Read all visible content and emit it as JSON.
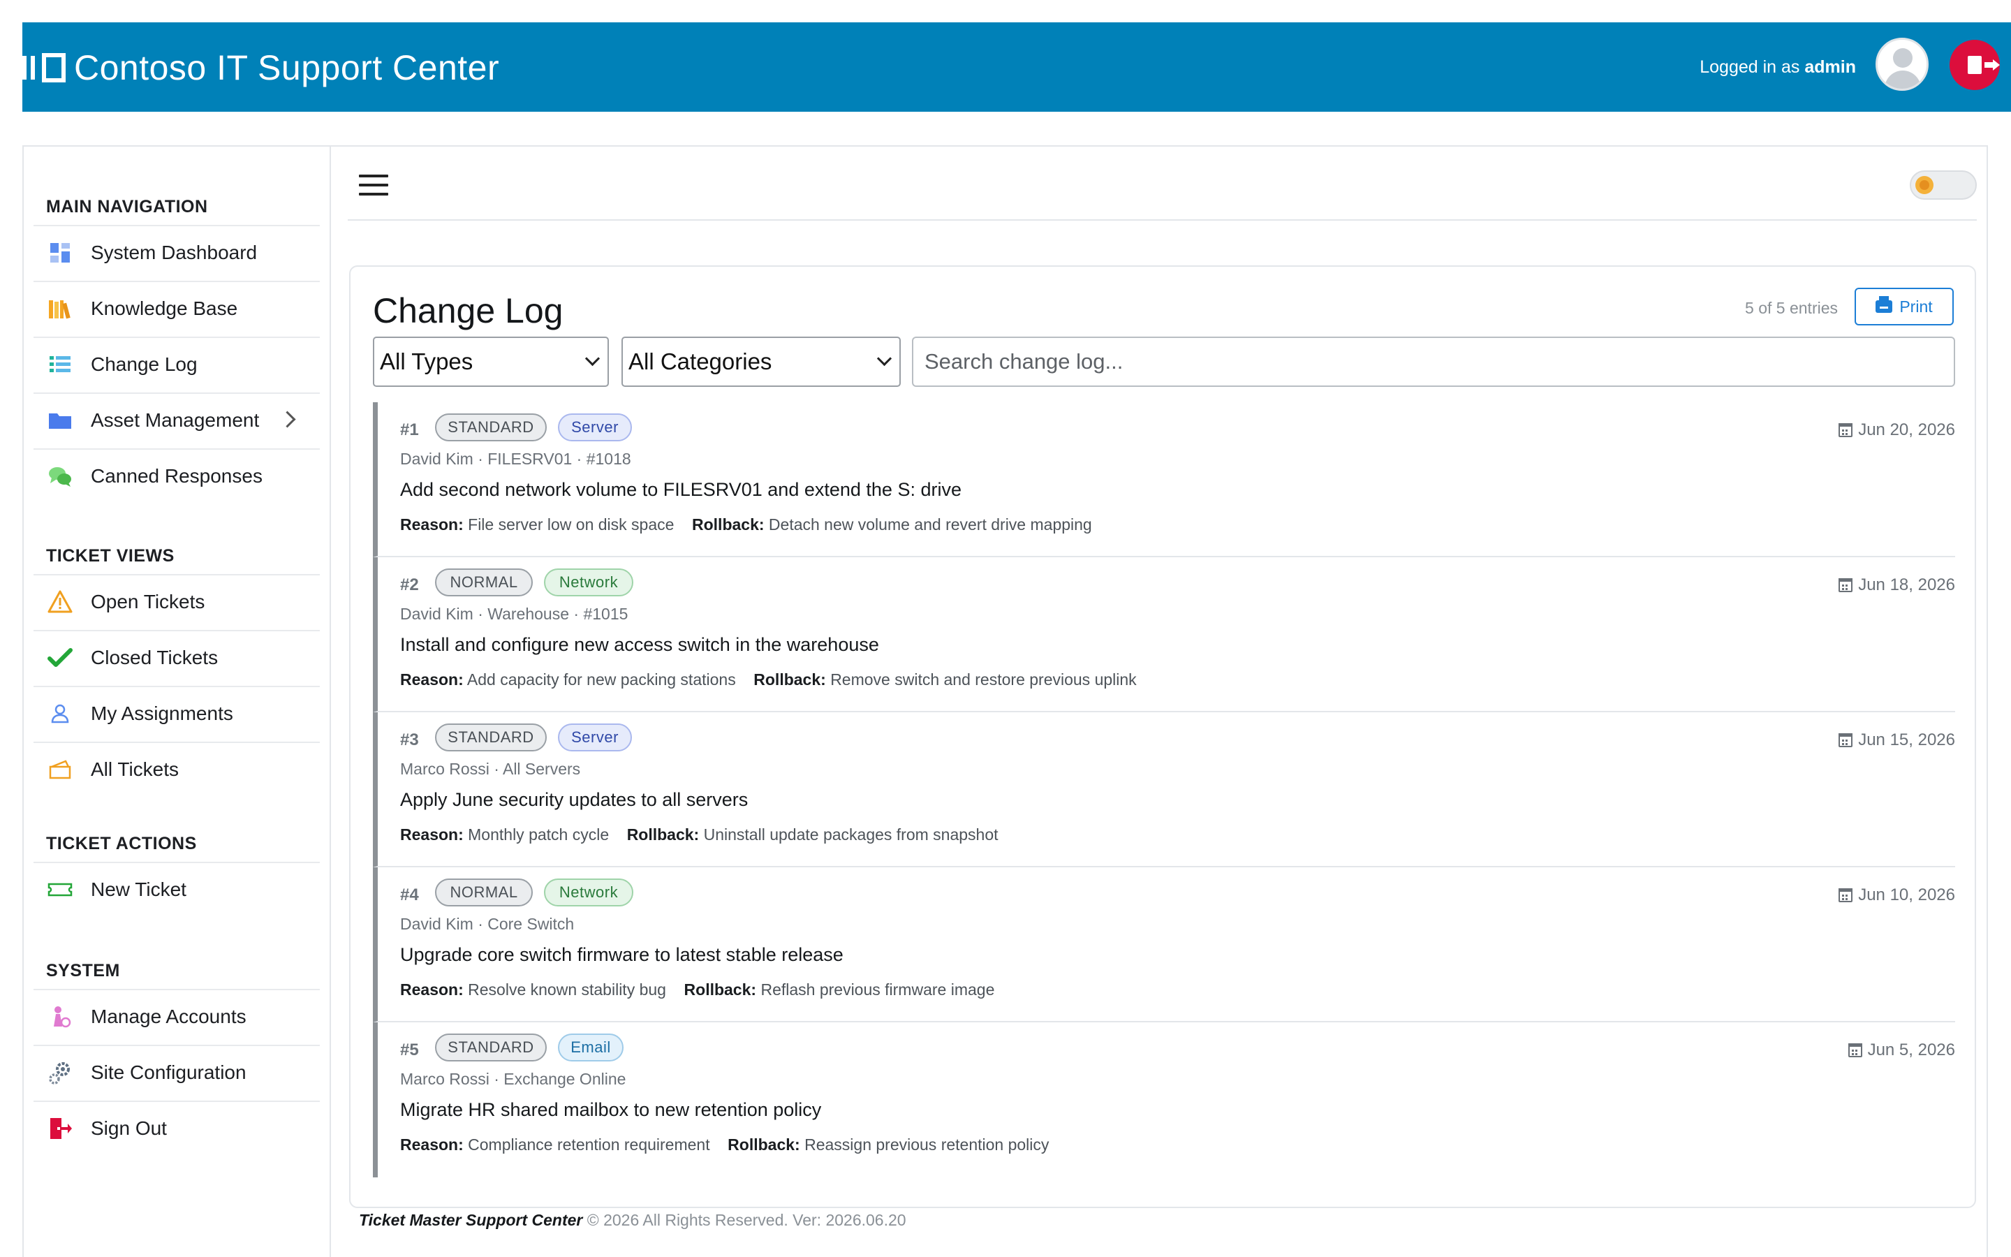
{
  "header": {
    "title": "Contoso IT Support Center",
    "logged_in_prefix": "Logged in as",
    "username": "admin",
    "brand_color": "#0081b8",
    "logout_color": "#dc0e3c"
  },
  "sidebar": {
    "sections": [
      {
        "heading": "MAIN NAVIGATION",
        "items": [
          {
            "label": "System Dashboard",
            "icon": "dashboard-icon"
          },
          {
            "label": "Knowledge Base",
            "icon": "books-icon"
          },
          {
            "label": "Change Log",
            "icon": "list-icon"
          },
          {
            "label": "Asset Management",
            "icon": "folder-icon"
          },
          {
            "label": "Canned Responses",
            "icon": "chat-bubbles-icon"
          }
        ]
      },
      {
        "heading": "TICKET VIEWS",
        "items": [
          {
            "label": "Open Tickets",
            "icon": "warning-icon"
          },
          {
            "label": "Closed Tickets",
            "icon": "checkmark-icon"
          },
          {
            "label": "My Assignments",
            "icon": "user-icon"
          },
          {
            "label": "All Tickets",
            "icon": "tickets-icon"
          }
        ]
      },
      {
        "heading": "TICKET ACTIONS",
        "items": [
          {
            "label": "New Ticket",
            "icon": "ticket-icon"
          }
        ]
      },
      {
        "heading": "SYSTEM",
        "items": [
          {
            "label": "Manage Accounts",
            "icon": "accounts-icon"
          },
          {
            "label": "Site Configuration",
            "icon": "gears-icon"
          },
          {
            "label": "Sign Out",
            "icon": "exit-icon"
          }
        ]
      }
    ]
  },
  "main": {
    "title": "Change Log",
    "entry_count": "5 of 5 entries",
    "print_label": "Print",
    "type_filter": "All Types",
    "category_filter": "All Categories",
    "search_placeholder": "Search change log...",
    "reason_label": "Reason:",
    "rollback_label": "Rollback:",
    "entries": [
      {
        "num": "#1",
        "type": "STANDARD",
        "category": "Server",
        "meta": "David Kim · FILESRV01 · #1018",
        "title": "Add second network volume to FILESRV01 and extend the S: drive",
        "reason": "File server low on disk space",
        "rollback": "Detach new volume and revert drive mapping",
        "date": "Jun 20, 2026"
      },
      {
        "num": "#2",
        "type": "NORMAL",
        "category": "Network",
        "meta": "David Kim · Warehouse · #1015",
        "title": "Install and configure new access switch in the warehouse",
        "reason": "Add capacity for new packing stations",
        "rollback": "Remove switch and restore previous uplink",
        "date": "Jun 18, 2026"
      },
      {
        "num": "#3",
        "type": "STANDARD",
        "category": "Server",
        "meta": "Marco Rossi · All Servers",
        "title": "Apply June security updates to all servers",
        "reason": "Monthly patch cycle",
        "rollback": "Uninstall update packages from snapshot",
        "date": "Jun 15, 2026"
      },
      {
        "num": "#4",
        "type": "NORMAL",
        "category": "Network",
        "meta": "David Kim · Core Switch",
        "title": "Upgrade core switch firmware to latest stable release",
        "reason": "Resolve known stability bug",
        "rollback": "Reflash previous firmware image",
        "date": "Jun 10, 2026"
      },
      {
        "num": "#5",
        "type": "STANDARD",
        "category": "Email",
        "meta": "Marco Rossi · Exchange Online",
        "title": "Migrate HR shared mailbox to new retention policy",
        "reason": "Compliance retention requirement",
        "rollback": "Reassign previous retention policy",
        "date": "Jun 5, 2026"
      }
    ]
  },
  "footer": {
    "app_name": "Ticket Master Support Center",
    "copyright": "© 2026 All Rights Reserved. Ver: 2026.06.20"
  }
}
